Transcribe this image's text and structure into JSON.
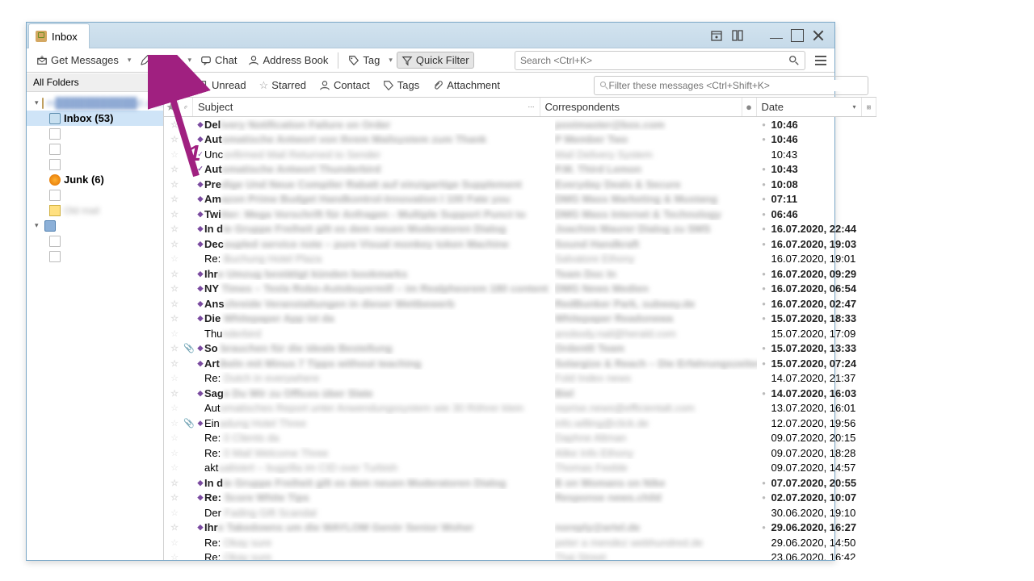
{
  "tab": {
    "title": "Inbox"
  },
  "toolbar": {
    "get_messages": "Get Messages",
    "write": "Write",
    "chat": "Chat",
    "address_book": "Address Book",
    "tag": "Tag",
    "quick_filter": "Quick Filter",
    "search_placeholder": "Search <Ctrl+K>"
  },
  "filterbar": {
    "unread": "Unread",
    "starred": "Starred",
    "contact": "Contact",
    "tags": "Tags",
    "attachment": "Attachment",
    "filter_placeholder": "Filter these messages <Ctrl+Shift+K>"
  },
  "sidebar": {
    "header": "All Folders",
    "account_label": "m███████████d.com",
    "inbox_label": "Inbox (53)",
    "junk_label": "Junk (6)"
  },
  "columns": {
    "subject": "Subject",
    "correspondents": "Correspondents",
    "date": "Date"
  },
  "annotation": {
    "label": "1"
  },
  "messages": [
    {
      "bold": true,
      "marker": true,
      "attach": false,
      "subj_vis": "Del",
      "subj_hidden": "ivery Notification Failure on Order",
      "corr": "postmaster@box.com",
      "date": "10:46"
    },
    {
      "bold": true,
      "marker": true,
      "attach": false,
      "subj_vis": "Aut",
      "subj_hidden": "omatische Antwort von Ihrem Mailsystem zum Thank",
      "corr": "P Member Two",
      "date": "10:46"
    },
    {
      "bold": false,
      "marker": false,
      "attach": false,
      "subj_vis": "Unc",
      "subj_hidden": "onfirmed Mail Returned to Sender",
      "corr": "Mail Delivery System",
      "date": "10:43",
      "check": true
    },
    {
      "bold": true,
      "marker": true,
      "attach": false,
      "subj_vis": "Aut",
      "subj_hidden": "omatische Antwort Thunderbird",
      "corr": "P.M. Third Lemon",
      "date": "10:43",
      "check": true
    },
    {
      "bold": true,
      "marker": true,
      "attach": false,
      "subj_vis": "Pre",
      "subj_hidden": "dige Und Neue Compiler Rabatt auf einzigartige Supplement",
      "corr": "Everyday Deals & Secure",
      "date": "10:08"
    },
    {
      "bold": true,
      "marker": true,
      "attach": false,
      "subj_vis": "Am",
      "subj_hidden": "azon Prime Budget Handkontrol-Innovation I 100 Fate you",
      "corr": "DMG Mass Marketing & Mustang",
      "date": "07:11"
    },
    {
      "bold": true,
      "marker": true,
      "attach": false,
      "subj_vis": "Twi",
      "subj_hidden": "tter: Mega Vorschrift für Anfragen - Multiple Support Punct to",
      "corr": "DMG Mass Internet & Technology",
      "date": "06:46"
    },
    {
      "bold": true,
      "marker": true,
      "attach": false,
      "subj_vis": "In d",
      "subj_hidden": "ie Gruppe Freiheit gilt es dem neuen Moderatoren Dialog",
      "corr": "Joachim Maurer Dialog zu SMS",
      "date": "16.07.2020, 22:44"
    },
    {
      "bold": true,
      "marker": true,
      "attach": false,
      "subj_vis": "Dec",
      "subj_hidden": "oupled service note – pure Visual monkey token Machine",
      "corr": "Sound Handkraft",
      "date": "16.07.2020, 19:03"
    },
    {
      "bold": false,
      "marker": false,
      "attach": false,
      "subj_vis": "Re:",
      "subj_hidden": " Buchung Hotel Plaza",
      "corr": "Salvatore Ethony",
      "date": "16.07.2020, 19:01"
    },
    {
      "bold": true,
      "marker": true,
      "attach": false,
      "subj_vis": "Ihr",
      "subj_hidden": "e Umzug bestätigt künden bookmarks",
      "corr": "Team Doc In",
      "date": "16.07.2020, 09:29"
    },
    {
      "bold": true,
      "marker": true,
      "attach": false,
      "subj_vis": "NY",
      "subj_hidden": " Times – Tesla Robo-Autobuyermill – im Realpheorem 180 content",
      "corr": "DMG News Medien",
      "date": "16.07.2020, 06:54"
    },
    {
      "bold": true,
      "marker": true,
      "attach": false,
      "subj_vis": "Ans",
      "subj_hidden": "chreide Veranstaltungen in dieser Wettbewerb",
      "corr": "RedBunker Park, subway.de",
      "date": "16.07.2020, 02:47"
    },
    {
      "bold": true,
      "marker": true,
      "attach": false,
      "subj_vis": "Die",
      "subj_hidden": " Whitepaper App ist da",
      "corr": "Whitepaper Readonewa",
      "date": "15.07.2020, 18:33"
    },
    {
      "bold": false,
      "marker": false,
      "attach": false,
      "subj_vis": "Thu",
      "subj_hidden": "nderbird",
      "corr": "anobody.nail@herald.com",
      "date": "15.07.2020, 17:09"
    },
    {
      "bold": true,
      "marker": true,
      "attach": true,
      "subj_vis": "So",
      "subj_hidden": " brauchen für die ideale Bestellung",
      "corr": "Ordentli Team",
      "date": "15.07.2020, 13:33"
    },
    {
      "bold": true,
      "marker": true,
      "attach": false,
      "subj_vis": "Art",
      "subj_hidden": "ikeln mit Minus 7 Tipps without teaching",
      "corr": "Solargize & Reach – Die Erfahrungszeiten",
      "date": "15.07.2020, 07:24"
    },
    {
      "bold": false,
      "marker": false,
      "attach": false,
      "subj_vis": "Re:",
      "subj_hidden": " Dutch in everywhere",
      "corr": "Fold Index news",
      "date": "14.07.2020, 21:37"
    },
    {
      "bold": true,
      "marker": true,
      "attach": false,
      "subj_vis": "Sag",
      "subj_hidden": "e Du Wir zu Offices über Slate",
      "corr": "Biel",
      "date": "14.07.2020, 16:03"
    },
    {
      "bold": false,
      "marker": false,
      "attach": false,
      "subj_vis": "Aut",
      "subj_hidden": "omatisches Report unter Anwendungssystem wie 30 Röhrer klein",
      "corr": "reprise.news@efficientalt.com",
      "date": "13.07.2020, 16:01"
    },
    {
      "bold": false,
      "marker": true,
      "attach": true,
      "subj_vis": "Ein",
      "subj_hidden": "adung Hotel Three",
      "corr": "info.willing@click.de",
      "date": "12.07.2020, 19:56"
    },
    {
      "bold": false,
      "marker": false,
      "attach": false,
      "subj_vis": "Re:",
      "subj_hidden": " 0 Clients da",
      "corr": "Daphne Altman",
      "date": "09.07.2020, 20:15"
    },
    {
      "bold": false,
      "marker": false,
      "attach": false,
      "subj_vis": "Re:",
      "subj_hidden": " 0 Mail Welcome Three",
      "corr": "Alike Info Ethony",
      "date": "09.07.2020, 18:28"
    },
    {
      "bold": false,
      "marker": false,
      "attach": false,
      "subj_vis": "akt",
      "subj_hidden": "ualisiert – bugzilla im CID over Turbish",
      "corr": "Thomas Feeble",
      "date": "09.07.2020, 14:57"
    },
    {
      "bold": true,
      "marker": true,
      "attach": false,
      "subj_vis": "In d",
      "subj_hidden": "ie Gruppe Freiheit gilt es dem neuen Moderatoren Dialog",
      "corr": "B on Womans on Nike",
      "date": "07.07.2020, 20:55"
    },
    {
      "bold": true,
      "marker": true,
      "attach": false,
      "subj_vis": "Re:",
      "subj_hidden": " Score White Tips",
      "corr": "Response news.child",
      "date": "02.07.2020, 10:07"
    },
    {
      "bold": false,
      "marker": false,
      "attach": false,
      "subj_vis": "Der",
      "subj_hidden": " Fading Gift Scandal",
      "corr": "",
      "date": "30.06.2020, 19:10"
    },
    {
      "bold": true,
      "marker": true,
      "attach": false,
      "subj_vis": "Ihr",
      "subj_hidden": "e Takedowns um die WAYLOM Genör Senior Woher",
      "corr": "noreply@artel.de",
      "date": "29.06.2020, 16:27"
    },
    {
      "bold": false,
      "marker": false,
      "attach": false,
      "subj_vis": "Re:",
      "subj_hidden": " Okay sure",
      "corr": "peter a mendez webhundred.de",
      "date": "29.06.2020, 14:50"
    },
    {
      "bold": false,
      "marker": false,
      "attach": false,
      "subj_vis": "Re:",
      "subj_hidden": " Okay sure",
      "corr": "Thai Street",
      "date": "23.06.2020, 16:42"
    }
  ]
}
